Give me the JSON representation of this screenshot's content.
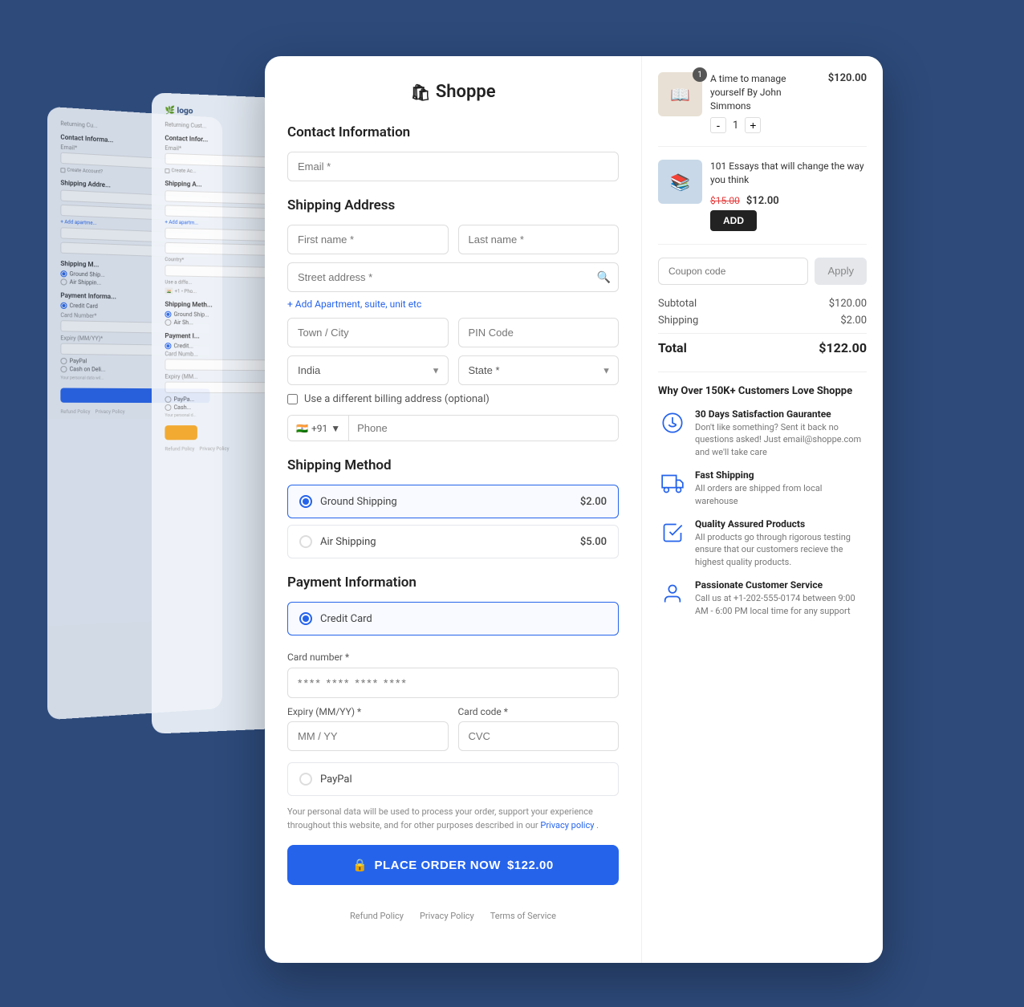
{
  "app": {
    "logo": "🛍",
    "title": "Shoppe"
  },
  "header": {
    "contact_info": "Contact Information",
    "shipping_address": "Shipping Address",
    "shipping_method": "Shipping Method",
    "payment_info": "Payment Information"
  },
  "form": {
    "email_placeholder": "Email *",
    "first_name_placeholder": "First name *",
    "last_name_placeholder": "Last name *",
    "street_placeholder": "Street address *",
    "add_apt": "+ Add Apartment, suite, unit etc",
    "town_placeholder": "Town / City",
    "pin_placeholder": "PIN Code",
    "country_label": "Country *",
    "country_value": "India",
    "state_label": "State *",
    "billing_checkbox": "Use a different billing address (optional)",
    "phone_code": "+91",
    "phone_placeholder": "Phone"
  },
  "shipping": {
    "ground_label": "Ground Shipping",
    "ground_price": "$2.00",
    "air_label": "Air Shipping",
    "air_price": "$5.00"
  },
  "payment": {
    "credit_card_label": "Credit Card",
    "card_number_label": "Card number *",
    "card_number_value": "**** **** **** ****",
    "expiry_label": "Expiry (MM/YY) *",
    "expiry_placeholder": "MM / YY",
    "cvc_label": "Card code *",
    "cvc_placeholder": "CVC",
    "paypal_label": "PayPal",
    "privacy_text": "Your personal data will be used to process your order, support your experience throughout this website, and for other purposes described in our ",
    "privacy_link": "Privacy policy",
    "privacy_end": "."
  },
  "order_button": {
    "lock_icon": "🔒",
    "label": "PLACE ORDER NOW",
    "price": "$122.00"
  },
  "footer": {
    "refund": "Refund Policy",
    "privacy": "Privacy Policy",
    "terms": "Terms of Service"
  },
  "sidebar": {
    "product1": {
      "name": "A time to manage yourself By John Simmons",
      "price": "$120.00",
      "qty": "1",
      "badge": "1"
    },
    "product2": {
      "name": "101 Essays that will change the way you think",
      "old_price": "$15.00",
      "new_price": "$12.00",
      "add_btn": "ADD"
    },
    "coupon_placeholder": "Coupon code",
    "apply_btn": "Apply",
    "subtotal_label": "Subtotal",
    "subtotal_value": "$120.00",
    "shipping_label": "Shipping",
    "shipping_value": "$2.00",
    "total_label": "Total",
    "total_value": "$122.00"
  },
  "trust": {
    "title": "Why Over 150K+ Customers Love Shoppe",
    "items": [
      {
        "title": "30 Days Satisfaction Gaurantee",
        "desc": "Don't like something? Sent it back no questions asked! Just email@shoppe.com and we'll take care"
      },
      {
        "title": "Fast Shipping",
        "desc": "All orders are shipped from local warehouse"
      },
      {
        "title": "Quality Assured Products",
        "desc": "All products go through rigorous testing ensure that our customers recieve the highest quality products."
      },
      {
        "title": "Passionate Customer Service",
        "desc": "Call us at +1-202-555-0174 between 9:00 AM - 6:00 PM local time for any support"
      }
    ]
  }
}
